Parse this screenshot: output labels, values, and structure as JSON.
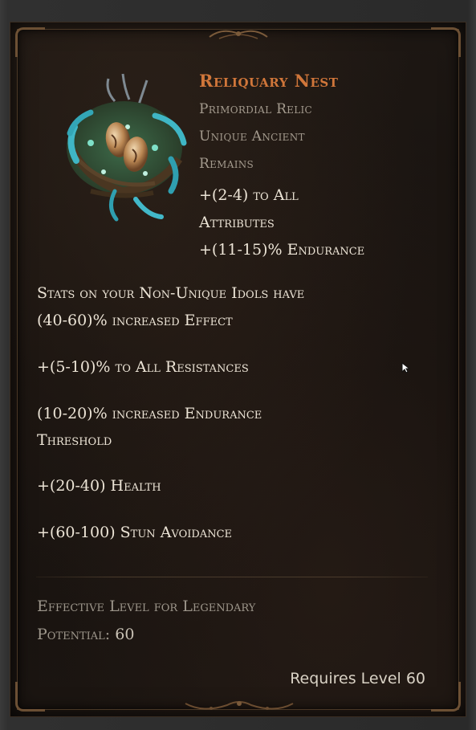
{
  "item": {
    "name": "Reliquary Nest",
    "type_lines": [
      "Primordial Relic",
      "Unique Ancient",
      "Remains"
    ],
    "implicits": [
      "+(2-4) to All",
      "Attributes",
      "+(11-15)% Endurance"
    ],
    "mods": [
      "Stats on your Non-Unique Idols have",
      "(40-60)% increased Effect",
      "+(5-10)% to All Resistances",
      "(10-20)% increased Endurance",
      "Threshold",
      "+(20-40) Health",
      "+(60-100) Stun Avoidance"
    ],
    "effective_level_label_1": "Effective Level for Legendary",
    "effective_level_label_2": "Potential:",
    "effective_level_value": "60",
    "requires_level": "Requires Level 60",
    "icon": "reliquary-nest-icon"
  },
  "colors": {
    "title": "#d0763a",
    "subtitle": "#a39a8d",
    "stat_text": "#ece4d6",
    "muted": "#9d968b",
    "panel_bg": "#1a1511",
    "frame": "#7a5a3a"
  }
}
